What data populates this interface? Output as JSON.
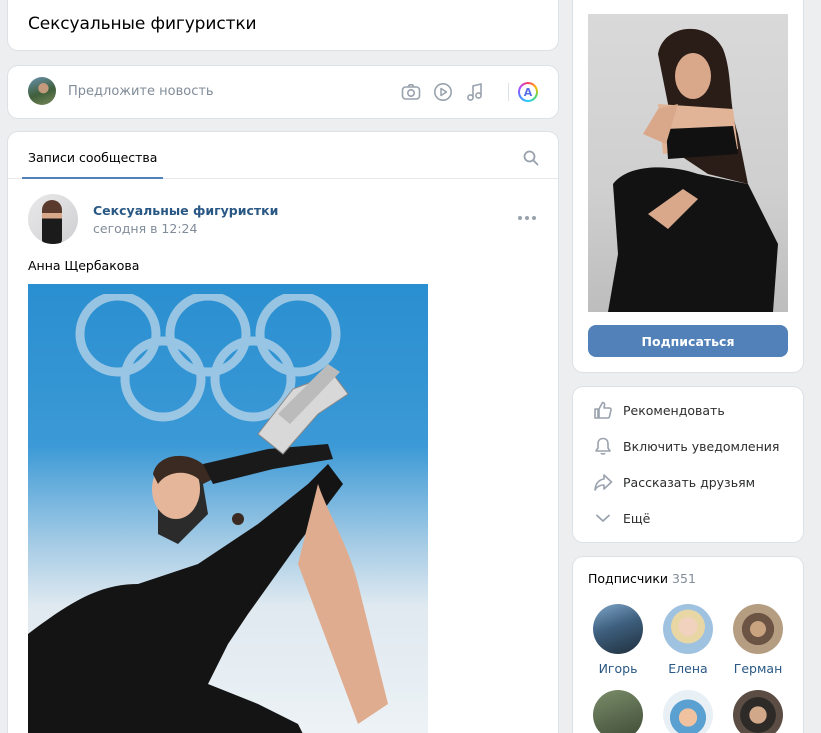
{
  "community": {
    "title": "Сексуальные фигуристки"
  },
  "composer": {
    "placeholder": "Предложите новость",
    "icons": [
      "camera-icon",
      "video-icon",
      "music-icon",
      "ai-icon"
    ],
    "ai_badge_letter": "A"
  },
  "feed": {
    "tabs": [
      {
        "label": "Записи сообщества",
        "active": true
      }
    ],
    "post": {
      "author": "Сексуальные фигуристки",
      "time": "сегодня в 12:24",
      "text": "Анна Щербакова"
    }
  },
  "sidebar": {
    "subscribe_label": "Подписаться",
    "actions": [
      {
        "label": "Рекомендовать",
        "icon": "thumbs-up-icon"
      },
      {
        "label": "Включить уведомления",
        "icon": "bell-icon"
      },
      {
        "label": "Рассказать друзьям",
        "icon": "share-icon"
      },
      {
        "label": "Ещё",
        "icon": "chevron-down-icon"
      }
    ],
    "subscribers": {
      "title": "Подписчики",
      "count": "351",
      "people": [
        {
          "name": "Игорь"
        },
        {
          "name": "Елена"
        },
        {
          "name": "Герман"
        }
      ]
    }
  },
  "colors": {
    "accent": "#5181b8",
    "link": "#2a5885",
    "background": "#edeef0",
    "muted": "#818c99"
  }
}
